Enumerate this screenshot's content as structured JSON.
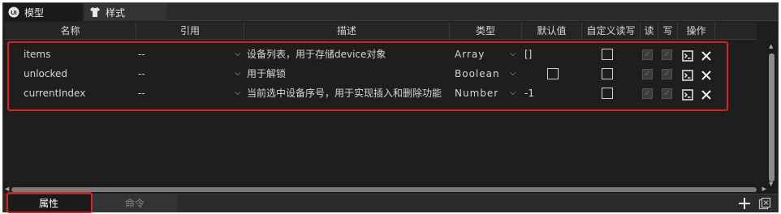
{
  "tabs": [
    {
      "label": "模型",
      "icon": "ui-logo-icon"
    },
    {
      "label": "样式",
      "icon": "shirt-icon"
    }
  ],
  "columns": [
    "名称",
    "引用",
    "描述",
    "类型",
    "默认值",
    "自定义读写",
    "读",
    "写",
    "操作"
  ],
  "rows": [
    {
      "name": "items",
      "ref": "--",
      "desc": "设备列表，用于存储device对象",
      "type": "Array",
      "default": "[]",
      "custom_rw": false,
      "read": true,
      "write": true
    },
    {
      "name": "unlocked",
      "ref": "--",
      "desc": "用于解锁",
      "type": "Boolean",
      "default": false,
      "custom_rw": false,
      "read": true,
      "write": true
    },
    {
      "name": "currentIndex",
      "ref": "--",
      "desc": "当前选中设备序号，用于实现插入和删除功能",
      "type": "Number",
      "default": "-1",
      "custom_rw": false,
      "read": true,
      "write": true
    }
  ],
  "bottom_tabs": [
    {
      "label": "属性",
      "active": true
    },
    {
      "label": "命令",
      "active": false
    }
  ],
  "colors": {
    "highlight": "#e02020",
    "background": "#1e1e1e"
  }
}
